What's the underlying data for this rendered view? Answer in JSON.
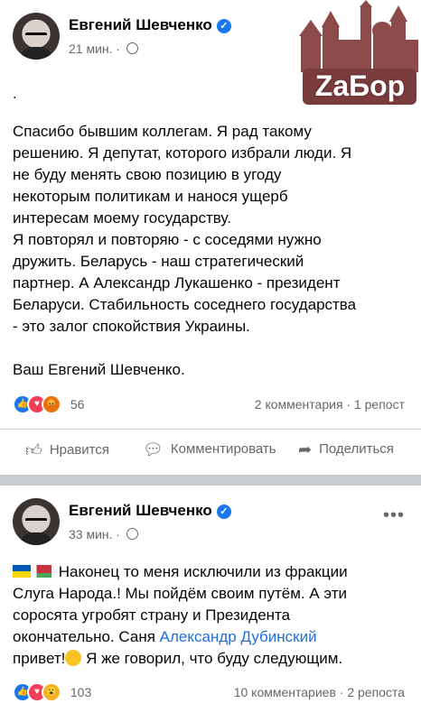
{
  "posts": [
    {
      "author": "Евгений Шевченко",
      "time": "21 мин. ·",
      "text_lines": [
        ".",
        "",
        "Спасибо бывшим  коллегам. Я рад такому",
        "решению. Я депутат, которого избрали люди. Я",
        "не буду менять свою позицию в угоду",
        "некоторым политикам и нанося ущерб",
        "интересам моему государству.",
        "Я повторял и повторяю - с соседями нужно",
        "дружить. Беларусь - наш стратегический",
        "партнер. А Александр Лукашенко - президент",
        "Беларуси. Стабильность соседнего государства",
        "- это залог спокойствия Украины.",
        "",
        " Ваш Евгений Шевченко."
      ],
      "reactions_count": "56",
      "stats": "2 комментария · 1 репост",
      "actions": {
        "like": "Нравится",
        "comment": "Комментировать",
        "share": "Поделиться"
      }
    },
    {
      "author": "Евгений Шевченко",
      "time": "33 мин. ·",
      "more": "•••",
      "text_line1": "Наконец то меня исключили из фракции",
      "text_line2": "Слуга Народа.! Мы пойдём своим путём. А эти",
      "text_line3": "соросята угробят страну и  Президента",
      "text_line4_a": "окончательно. Саня ",
      "text_line4_link": "Александр Дубинский",
      "text_line5_a": "привет!",
      "text_line5_b": " Я же говорил, что буду следующим.",
      "reactions_count": "103",
      "stats": "10 комментариев · 2 репоста"
    }
  ],
  "logo": {
    "text": "ZаБор",
    "colors": {
      "primary": "#8c4a4a"
    }
  },
  "colors": {
    "accent": "#1877f2",
    "secondary_text": "#65676b",
    "link": "#216fdb"
  }
}
